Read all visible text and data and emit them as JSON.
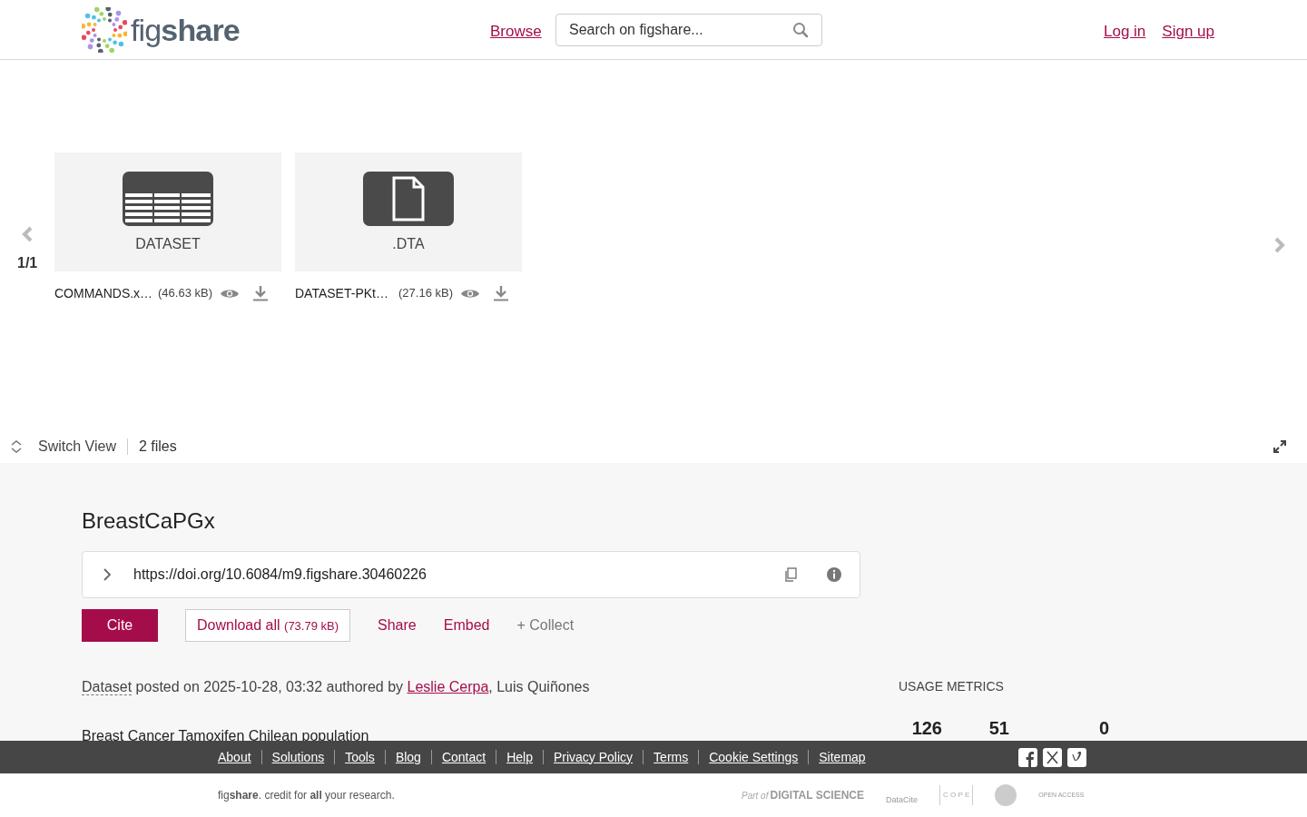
{
  "header": {
    "logo": "fig**share**",
    "nav_link": "Browse",
    "search": {
      "placeholder": "Search on figshare..."
    },
    "auth_links": [
      "Log in",
      "Sign up"
    ]
  },
  "viewer": {
    "page_indicator": "1/1",
    "files": [
      {
        "kind": "table",
        "type_label": "DATASET",
        "name": "COMMANDS.x…",
        "size": "(46.63 kB)"
      },
      {
        "kind": "document",
        "type_label": ".DTA",
        "name": "DATASET-PKt…",
        "size": "(27.16 kB)"
      }
    ],
    "switch_view": "Switch View",
    "file_count": "2 files"
  },
  "item": {
    "title": "BreastCaPGx",
    "doi": "https://doi.org/10.6084/m9.figshare.30460226",
    "actions": {
      "cite": "Cite",
      "download": "Download all",
      "download_size": "(73.79 kB)",
      "links": [
        "Share",
        "Embed"
      ],
      "collect": "+ Collect"
    },
    "posted": {
      "type": "Dataset",
      "text": "posted on 2025-10-28, 03:32 authored by",
      "separator": ",",
      "authors": [
        {
          "name": "Leslie Cerpa",
          "linked": true
        },
        {
          "name": "Luis Quiñones",
          "linked": false
        }
      ]
    },
    "description": "Breast Cancer Tamoxifen Chilean population",
    "usage_metrics": {
      "heading": "USAGE METRICS",
      "values": [
        "126",
        "51",
        "0"
      ]
    }
  },
  "footer": {
    "links": [
      "About",
      "Solutions",
      "Tools",
      "Blog",
      "Contact",
      "Help",
      "Privacy Policy",
      "Terms",
      "Cookie Settings",
      "Sitemap"
    ],
    "tagline": "fig**share**. credit for **all** your research.",
    "partners": [
      {
        "kind": "digital_science",
        "text": "Part of"
      },
      {
        "kind": "digital_science_name",
        "text": "DIGITAL SCIENCE"
      },
      {
        "kind": "datacite",
        "text": "DataCite"
      },
      {
        "kind": "cope",
        "text": "C O P E"
      },
      {
        "kind": "seal"
      },
      {
        "kind": "open_access",
        "text": "OPEN ACCESS"
      }
    ]
  }
}
